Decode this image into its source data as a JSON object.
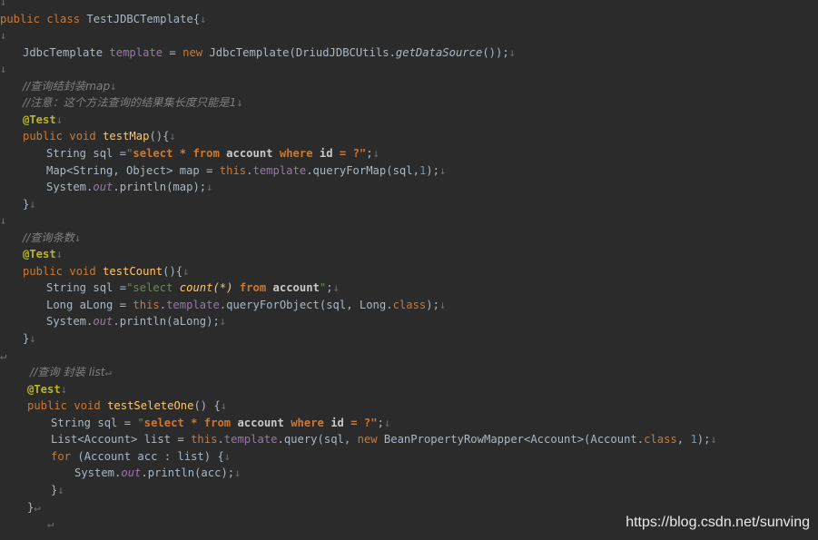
{
  "editor": {
    "language": "Java",
    "pilcrow": "↓",
    "alt_mark": "↵",
    "lines": [
      {
        "indent": 0,
        "tokens": [
          {
            "t": "↓",
            "c": "pm"
          }
        ]
      },
      {
        "indent": 0,
        "tokens": [
          {
            "t": "public",
            "c": "kw"
          },
          {
            "t": " "
          },
          {
            "t": "class",
            "c": "kw"
          },
          {
            "t": " TestJDBCTemplate{"
          },
          {
            "t": "↓",
            "c": "pm"
          }
        ]
      },
      {
        "indent": 0,
        "tokens": [
          {
            "t": "↓",
            "c": "pm"
          }
        ]
      },
      {
        "indent": 25,
        "tokens": [
          {
            "t": "JdbcTemplate "
          },
          {
            "t": "template",
            "c": "fld"
          },
          {
            "t": " = "
          },
          {
            "t": "new",
            "c": "kw"
          },
          {
            "t": " JdbcTemplate(DriudJDBCUtils."
          },
          {
            "t": "getDataSource",
            "c": "smeth"
          },
          {
            "t": "());"
          },
          {
            "t": "↓",
            "c": "pm"
          }
        ]
      },
      {
        "indent": 0,
        "tokens": [
          {
            "t": "↓",
            "c": "pm"
          }
        ]
      },
      {
        "indent": 25,
        "tokens": [
          {
            "t": "//查询结封装map",
            "c": "cmt"
          },
          {
            "t": "↓",
            "c": "pm"
          }
        ]
      },
      {
        "indent": 25,
        "tokens": [
          {
            "t": "//注意：这个方法查询的结果集长度只能是1",
            "c": "cmt"
          },
          {
            "t": "↓",
            "c": "pm"
          }
        ]
      },
      {
        "indent": 25,
        "tokens": [
          {
            "t": "@Test",
            "c": "ann"
          },
          {
            "t": "↓",
            "c": "pm"
          }
        ]
      },
      {
        "indent": 25,
        "tokens": [
          {
            "t": "public",
            "c": "kw"
          },
          {
            "t": " "
          },
          {
            "t": "void",
            "c": "kw"
          },
          {
            "t": " "
          },
          {
            "t": "testMap",
            "c": "fn"
          },
          {
            "t": "(){"
          },
          {
            "t": "↓",
            "c": "pm"
          }
        ]
      },
      {
        "indent": 51,
        "tokens": [
          {
            "t": "String sql ="
          },
          {
            "t": "\"",
            "c": "str"
          },
          {
            "t": "select * from",
            "c": "sqlkw"
          },
          {
            "t": " "
          },
          {
            "t": "account",
            "c": "sqlid"
          },
          {
            "t": " "
          },
          {
            "t": "where",
            "c": "sqlkw"
          },
          {
            "t": " "
          },
          {
            "t": "id",
            "c": "sqlid"
          },
          {
            "t": " = ?\"",
            "c": "sqlkw"
          },
          {
            "t": ";"
          },
          {
            "t": "↓",
            "c": "pm"
          }
        ]
      },
      {
        "indent": 51,
        "tokens": [
          {
            "t": "Map<String, Object> map = "
          },
          {
            "t": "this",
            "c": "kw"
          },
          {
            "t": "."
          },
          {
            "t": "template",
            "c": "fld"
          },
          {
            "t": ".queryForMap(sql,"
          },
          {
            "t": "1",
            "c": "num"
          },
          {
            "t": ");"
          },
          {
            "t": "↓",
            "c": "pm"
          }
        ]
      },
      {
        "indent": 51,
        "tokens": [
          {
            "t": "System."
          },
          {
            "t": "out",
            "c": "sfld"
          },
          {
            "t": ".println(map);"
          },
          {
            "t": "↓",
            "c": "pm"
          }
        ]
      },
      {
        "indent": 25,
        "tokens": [
          {
            "t": "}"
          },
          {
            "t": "↓",
            "c": "pm"
          }
        ]
      },
      {
        "indent": 0,
        "tokens": [
          {
            "t": "↓",
            "c": "pm"
          }
        ]
      },
      {
        "indent": 25,
        "tokens": [
          {
            "t": "//查询条数",
            "c": "cmt"
          },
          {
            "t": "↓",
            "c": "pm"
          }
        ]
      },
      {
        "indent": 25,
        "tokens": [
          {
            "t": "@Test",
            "c": "ann"
          },
          {
            "t": "↓",
            "c": "pm"
          }
        ]
      },
      {
        "indent": 25,
        "tokens": [
          {
            "t": "public",
            "c": "kw"
          },
          {
            "t": " "
          },
          {
            "t": "void",
            "c": "kw"
          },
          {
            "t": " "
          },
          {
            "t": "testCount",
            "c": "fn"
          },
          {
            "t": "(){"
          },
          {
            "t": "↓",
            "c": "pm"
          }
        ]
      },
      {
        "indent": 51,
        "tokens": [
          {
            "t": "String sql ="
          },
          {
            "t": "\"select ",
            "c": "str"
          },
          {
            "t": "count(*)",
            "c": "sqlfn"
          },
          {
            "t": " "
          },
          {
            "t": "from",
            "c": "sqlkw"
          },
          {
            "t": " "
          },
          {
            "t": "account",
            "c": "sqlid"
          },
          {
            "t": "\"",
            "c": "str"
          },
          {
            "t": ";"
          },
          {
            "t": "↓",
            "c": "pm"
          }
        ]
      },
      {
        "indent": 51,
        "tokens": [
          {
            "t": "Long aLong = "
          },
          {
            "t": "this",
            "c": "kw"
          },
          {
            "t": "."
          },
          {
            "t": "template",
            "c": "fld"
          },
          {
            "t": ".queryForObject(sql, Long."
          },
          {
            "t": "class",
            "c": "kw"
          },
          {
            "t": ");"
          },
          {
            "t": "↓",
            "c": "pm"
          }
        ]
      },
      {
        "indent": 51,
        "tokens": [
          {
            "t": "System."
          },
          {
            "t": "out",
            "c": "sfld"
          },
          {
            "t": ".println(aLong);"
          },
          {
            "t": "↓",
            "c": "pm"
          }
        ]
      },
      {
        "indent": 25,
        "tokens": [
          {
            "t": "}"
          },
          {
            "t": "↓",
            "c": "pm"
          }
        ]
      },
      {
        "indent": 0,
        "tokens": [
          {
            "t": "↵",
            "c": "pm"
          }
        ]
      },
      {
        "indent": 33,
        "tokens": [
          {
            "t": "//查询 封装 list",
            "c": "cmt"
          },
          {
            "t": "↵",
            "c": "pm"
          }
        ]
      },
      {
        "indent": 30,
        "tokens": [
          {
            "t": "@Test",
            "c": "ann"
          },
          {
            "t": "↓",
            "c": "pm"
          }
        ]
      },
      {
        "indent": 30,
        "tokens": [
          {
            "t": "public",
            "c": "kw"
          },
          {
            "t": " "
          },
          {
            "t": "void",
            "c": "kw"
          },
          {
            "t": " "
          },
          {
            "t": "testSeleteOne",
            "c": "fn"
          },
          {
            "t": "() {"
          },
          {
            "t": "↓",
            "c": "pm"
          }
        ]
      },
      {
        "indent": 56,
        "tokens": [
          {
            "t": "String sql = "
          },
          {
            "t": "\"",
            "c": "str"
          },
          {
            "t": "select * from",
            "c": "sqlkw"
          },
          {
            "t": " "
          },
          {
            "t": "account",
            "c": "sqlid"
          },
          {
            "t": " "
          },
          {
            "t": "where",
            "c": "sqlkw"
          },
          {
            "t": " "
          },
          {
            "t": "id",
            "c": "sqlid"
          },
          {
            "t": " = ?\"",
            "c": "sqlkw"
          },
          {
            "t": ";"
          },
          {
            "t": "↓",
            "c": "pm"
          }
        ]
      },
      {
        "indent": 56,
        "tokens": [
          {
            "t": "List<Account> list = "
          },
          {
            "t": "this",
            "c": "kw"
          },
          {
            "t": "."
          },
          {
            "t": "template",
            "c": "fld"
          },
          {
            "t": ".query(sql, "
          },
          {
            "t": "new",
            "c": "kw"
          },
          {
            "t": " BeanPropertyRowMapper<Account>(Account."
          },
          {
            "t": "class",
            "c": "kw"
          },
          {
            "t": ", "
          },
          {
            "t": "1",
            "c": "num"
          },
          {
            "t": ");"
          },
          {
            "t": "↓",
            "c": "pm"
          }
        ]
      },
      {
        "indent": 56,
        "tokens": [
          {
            "t": "for",
            "c": "kw"
          },
          {
            "t": " (Account acc : list) {"
          },
          {
            "t": "↓",
            "c": "pm"
          }
        ]
      },
      {
        "indent": 82,
        "tokens": [
          {
            "t": "System."
          },
          {
            "t": "out",
            "c": "sfld"
          },
          {
            "t": ".println(acc);"
          },
          {
            "t": "↓",
            "c": "pm"
          }
        ]
      },
      {
        "indent": 56,
        "tokens": [
          {
            "t": "}"
          },
          {
            "t": "↓",
            "c": "pm"
          }
        ]
      },
      {
        "indent": 30,
        "tokens": [
          {
            "t": "}"
          },
          {
            "t": "↵",
            "c": "pm"
          }
        ]
      },
      {
        "indent": 52,
        "tokens": [
          {
            "t": "↵",
            "c": "pm"
          }
        ]
      }
    ]
  },
  "watermark": "https://blog.csdn.net/sunving"
}
